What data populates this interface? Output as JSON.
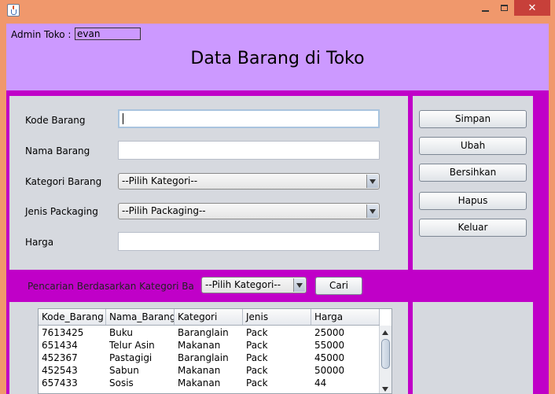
{
  "window": {
    "icon": "java-cup-icon",
    "close_glyph": "✕",
    "accent_titlebar": "#f0986c",
    "accent_close": "#c7403a"
  },
  "header": {
    "admin_label": "Admin Toko :",
    "admin_value": "evan",
    "title": "Data Barang di Toko",
    "bg_color": "#cc99ff"
  },
  "form": {
    "kode_label": "Kode Barang",
    "kode_value": "",
    "nama_label": "Nama Barang",
    "nama_value": "",
    "kategori_label": "Kategori Barang",
    "kategori_selected": "--Pilih Kategori--",
    "jenis_label": "Jenis Packaging",
    "jenis_selected": "--Pilih Packaging--",
    "harga_label": "Harga",
    "harga_value": ""
  },
  "buttons": {
    "simpan": "Simpan",
    "ubah": "Ubah",
    "bersihkan": "Bersihkan",
    "hapus": "Hapus",
    "keluar": "Keluar"
  },
  "search": {
    "label": "Pencarian Berdasarkan Kategori Barang",
    "category_selected": "--Pilih Kategori--",
    "button_label": "Cari"
  },
  "table": {
    "columns": [
      "Kode_Barang",
      "Nama_Barang",
      "Kategori",
      "Jenis",
      "Harga"
    ],
    "rows": [
      [
        "7613425",
        "Buku",
        "Baranglain",
        "Pack",
        "25000"
      ],
      [
        "651434",
        "Telur Asin",
        "Makanan",
        "Pack",
        "55000"
      ],
      [
        "452367",
        "Pastagigi",
        "Baranglain",
        "Pack",
        "45000"
      ],
      [
        "452543",
        "Sabun",
        "Makanan",
        "Pack",
        "50000"
      ],
      [
        "657433",
        "Sosis",
        "Makanan",
        "Pack",
        "44"
      ]
    ]
  },
  "colors": {
    "content_bg": "#c000c8",
    "panel_bg": "#d6d9df"
  }
}
